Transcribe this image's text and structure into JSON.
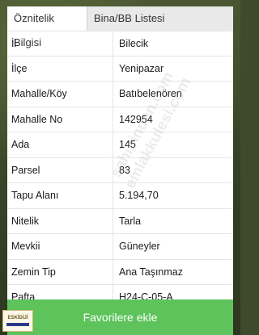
{
  "tabs": [
    {
      "label": "Öznitelik Bilgisi"
    },
    {
      "label": "Bina/BB Listesi"
    }
  ],
  "rows": [
    {
      "key": "İl",
      "value": "Bilecik"
    },
    {
      "key": "İlçe",
      "value": "Yenipazar"
    },
    {
      "key": "Mahalle/Köy",
      "value": "Batıbelenören"
    },
    {
      "key": "Mahalle No",
      "value": "142954"
    },
    {
      "key": "Ada",
      "value": "145"
    },
    {
      "key": "Parsel",
      "value": "83"
    },
    {
      "key": "Tapu Alanı",
      "value": "5.194,70"
    },
    {
      "key": "Nitelik",
      "value": "Tarla"
    },
    {
      "key": "Mevkii",
      "value": "Güneyler"
    },
    {
      "key": "Zemin Tip",
      "value": "Ana Taşınmaz"
    },
    {
      "key": "Pafta",
      "value": "H24-C-05-A"
    }
  ],
  "watermark": {
    "line1": "sahibinden.com",
    "line2": "emlakkulesi.com"
  },
  "favorite_button": {
    "label": "Favorilere ekle"
  },
  "logo": {
    "text": "ESKİDİJİ"
  },
  "colors": {
    "accent": "#5dc35a",
    "tab_bg": "#e9e9e9"
  }
}
